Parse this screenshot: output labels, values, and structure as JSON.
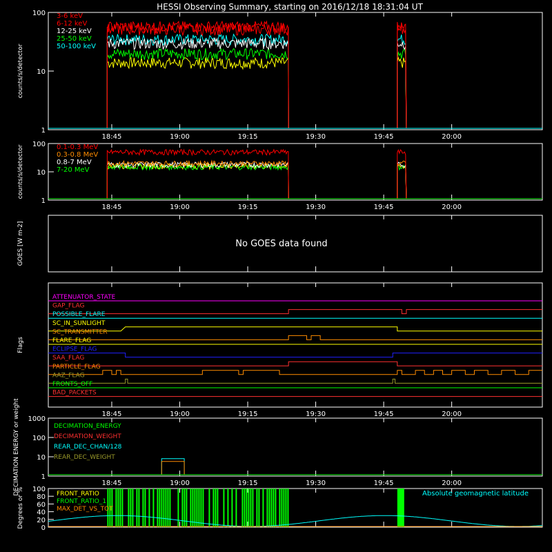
{
  "title": "HESSI Observing Summary, starting on 2016/12/18 18:31:04 UT",
  "time_ticks": [
    "18:45",
    "19:00",
    "19:15",
    "19:30",
    "19:45",
    "20:00"
  ],
  "chart_data": [
    {
      "type": "line",
      "ylabel": "counts/s/detector",
      "scale": "log",
      "ylim": [
        1,
        100
      ],
      "y_ticks": [
        "1",
        "10",
        "100"
      ],
      "legend_placement": "top-left",
      "series": [
        {
          "name": "3-6 keV",
          "color": "#ff0000",
          "level": 58
        },
        {
          "name": "6-12 keV",
          "color": "#ff0000",
          "level": 52
        },
        {
          "name": "12-25 keV",
          "color": "#ffffff",
          "level": 30
        },
        {
          "name": "25-50 keV",
          "color": "#00ff00",
          "level": 20
        },
        {
          "name": "50-100 keV",
          "color": "#00ffff",
          "level": 35
        },
        {
          "name": "",
          "color": "#ffff00",
          "level": 14
        }
      ],
      "active_windows": [
        [
          "18:44",
          "19:24"
        ],
        [
          "19:48",
          "19:50"
        ]
      ]
    },
    {
      "type": "line",
      "ylabel": "counts/s/detector",
      "scale": "log",
      "ylim": [
        1,
        100
      ],
      "y_ticks": [
        "1",
        "10",
        "100"
      ],
      "legend_placement": "top-left",
      "series": [
        {
          "name": "0.1-0.3 MeV",
          "color": "#ff0000",
          "level": 50
        },
        {
          "name": "0.3-0.8 MeV",
          "color": "#ff8c00",
          "level": 20
        },
        {
          "name": "0.8-7 MeV",
          "color": "#ffffff",
          "level": 18
        },
        {
          "name": "7-20 MeV",
          "color": "#00ff00",
          "level": 15
        },
        {
          "name": "",
          "color": "#ffff00",
          "level": 16
        }
      ],
      "active_windows": [
        [
          "18:44",
          "19:24"
        ],
        [
          "19:48",
          "19:50"
        ]
      ]
    },
    {
      "type": "line",
      "ylabel": "GOES [W m-2]",
      "message": "No GOES data found"
    },
    {
      "type": "line",
      "ylabel": "Flags",
      "flags": [
        {
          "name": "ATTENUATOR_STATE",
          "color": "#ff00ff"
        },
        {
          "name": "GAP_FLAG",
          "color": "#ff3030"
        },
        {
          "name": "POSSIBLE_FLARE",
          "color": "#00ffff"
        },
        {
          "name": "SC_IN_SUNLIGHT",
          "color": "#ffff00"
        },
        {
          "name": "SC_TRANSMITTER",
          "color": "#ff8c00"
        },
        {
          "name": "FLARE_FLAG",
          "color": "#ffff00"
        },
        {
          "name": "ECLIPSE_FLAG",
          "color": "#2020ff"
        },
        {
          "name": "SAA_FLAG",
          "color": "#ff3030"
        },
        {
          "name": "PARTICLE_FLAG",
          "color": "#ff8c00"
        },
        {
          "name": "AAZ_FLAG",
          "color": "#9a9a2a"
        },
        {
          "name": "FRONTS_OFF",
          "color": "#00ff00"
        },
        {
          "name": "BAD_PACKETS",
          "color": "#ff3030"
        }
      ]
    },
    {
      "type": "line",
      "ylabel": "DECIMATION ENERGY or weight",
      "scale": "log",
      "ylim": [
        1,
        1000
      ],
      "y_ticks": [
        "1",
        "10",
        "100",
        "1000"
      ],
      "legend_placement": "top-left",
      "series": [
        {
          "name": "DECIMATION_ENERGY",
          "color": "#00ff00"
        },
        {
          "name": "DECIMATION_WEIGHT",
          "color": "#ff3030"
        },
        {
          "name": "REAR_DEC_CHAN/128",
          "color": "#00ffff"
        },
        {
          "name": "REAR_DEC_WEIGHT",
          "color": "#9a9a2a"
        }
      ],
      "step": {
        "x": [
          "18:56",
          "19:01"
        ],
        "value": 8
      }
    },
    {
      "type": "line",
      "ylabel": "Degrees or %",
      "ylim": [
        0,
        100
      ],
      "y_ticks": [
        "0",
        "20",
        "40",
        "60",
        "80",
        "100"
      ],
      "legend_placement": "top-left",
      "series": [
        {
          "name": "FRONT_RATIO",
          "color": "#ffff00"
        },
        {
          "name": "FRONT_RATIO_1",
          "color": "#00ff00"
        },
        {
          "name": "MAX_DET_VS_TOT",
          "color": "#ff8c00"
        }
      ],
      "right_label": "Absolute geomagnetic latitude",
      "right_label_color": "#00ffff"
    }
  ]
}
